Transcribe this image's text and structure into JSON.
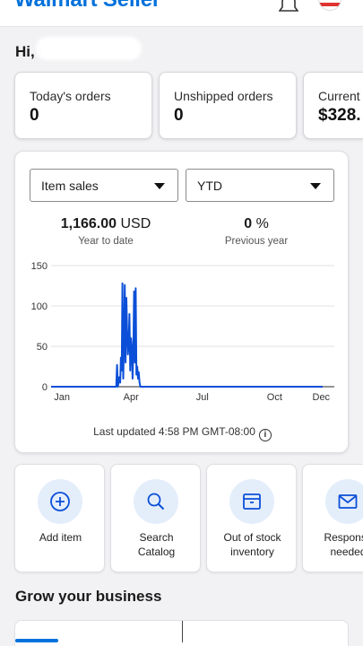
{
  "header": {
    "brand": "Walmart Seller",
    "bell_icon": "bell-icon",
    "flag_icon": "us-flag-icon"
  },
  "greeting": "Hi, ·",
  "stats": [
    {
      "label": "Today's orders",
      "value": "0"
    },
    {
      "label": "Unshipped orders",
      "value": "0"
    },
    {
      "label": "Current",
      "value": "$328."
    }
  ],
  "sales": {
    "metric_select": "Item sales",
    "period_select": "YTD",
    "total_value": "1,166.00",
    "total_unit": "USD",
    "total_caption": "Year to date",
    "change_value": "0",
    "change_unit": "%",
    "change_caption": "Previous year",
    "last_updated": "Last updated 4:58 PM GMT-08:00",
    "info_icon": "info-icon"
  },
  "chart_data": {
    "type": "line",
    "title": "",
    "xlabel": "",
    "ylabel": "",
    "x_tick_labels": [
      "Jan",
      "Apr",
      "Jul",
      "Oct",
      "Dec"
    ],
    "y_tick_labels": [
      "0",
      "50",
      "100",
      "150"
    ],
    "ylim": [
      0,
      150
    ],
    "grid": true,
    "series": [
      {
        "color": "#0b4fd8",
        "x": [
          0,
          84,
          85,
          86,
          88,
          89,
          90,
          91,
          92,
          93,
          94,
          95,
          96,
          97,
          98,
          99,
          100,
          101,
          102,
          103,
          104,
          105,
          106,
          107,
          108,
          109,
          110,
          111,
          112,
          113,
          114,
          115,
          120,
          350
        ],
        "values": [
          0,
          0,
          27,
          0,
          12,
          5,
          36,
          20,
          128,
          10,
          60,
          126,
          30,
          110,
          70,
          40,
          55,
          90,
          20,
          60,
          50,
          10,
          45,
          118,
          30,
          122,
          15,
          25,
          10,
          18,
          5,
          0,
          0,
          0
        ]
      }
    ]
  },
  "actions": [
    {
      "label": "Add item",
      "icon": "add-circle-icon"
    },
    {
      "label": "Search Catalog",
      "icon": "search-icon"
    },
    {
      "label": "Out of stock inventory",
      "icon": "box-icon"
    },
    {
      "label": "Response needed",
      "icon": "mail-icon"
    }
  ],
  "grow": {
    "title": "Grow your business"
  }
}
